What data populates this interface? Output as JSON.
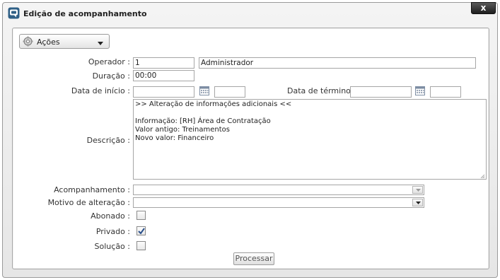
{
  "window": {
    "title": "Edição de acompanhamento",
    "close_label": "x",
    "icon": "chat-window-icon"
  },
  "actions_menu": {
    "label": "Ações",
    "icon": "gear-icon"
  },
  "form": {
    "operador": {
      "label": "Operador :",
      "code": "1",
      "name": "Administrador"
    },
    "duracao": {
      "label": "Duração :",
      "value": "00:00"
    },
    "data_inicio": {
      "label": "Data de início :",
      "date": "",
      "time": ""
    },
    "data_termino": {
      "label": "Data de término :",
      "date": "",
      "time": ""
    },
    "descricao": {
      "label": "Descrição :",
      "lines": [
        ">> Alteração de informações adicionais <<",
        "",
        "Informação: [RH] Área de Contratação",
        "Valor antigo: Treinamentos",
        "Novo valor: Financeiro"
      ]
    },
    "acompanhamento": {
      "label": "Acompanhamento :",
      "value": ""
    },
    "motivo_alteracao": {
      "label": "Motivo de alteração :",
      "value": ""
    },
    "abonado": {
      "label": "Abonado :",
      "checked": false
    },
    "privado": {
      "label": "Privado :",
      "checked": true
    },
    "solucao": {
      "label": "Solução :",
      "checked": false
    },
    "submit_label": "Processar"
  },
  "colors": {
    "window_icon": "#2f5f86",
    "check_mark": "#2a4f8a"
  }
}
